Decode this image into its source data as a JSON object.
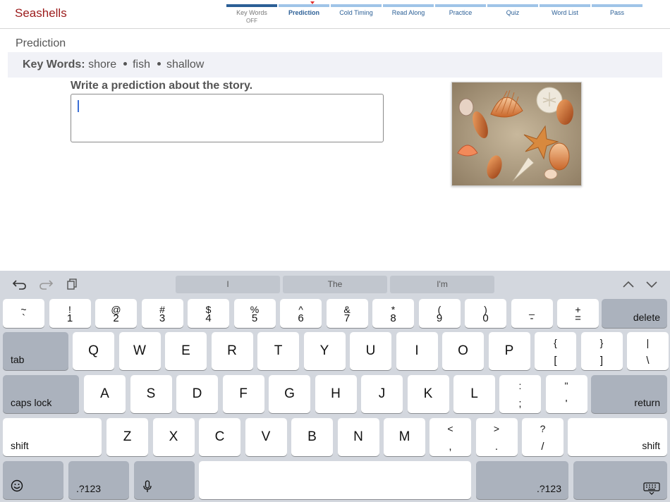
{
  "header": {
    "title": "Seashells"
  },
  "steps": [
    {
      "label": "Key Words",
      "sub": "OFF",
      "state": "done"
    },
    {
      "label": "Prediction",
      "state": "active"
    },
    {
      "label": "Cold Timing",
      "state": "todo"
    },
    {
      "label": "Read Along",
      "state": "todo"
    },
    {
      "label": "Practice",
      "state": "todo"
    },
    {
      "label": "Quiz",
      "state": "todo"
    },
    {
      "label": "Word List",
      "state": "todo"
    },
    {
      "label": "Pass",
      "state": "todo"
    }
  ],
  "section": {
    "title": "Prediction"
  },
  "keywords": {
    "label": "Key Words:",
    "words": [
      "shore",
      "fish",
      "shallow"
    ]
  },
  "prompt": {
    "text": "Write a prediction about the story.",
    "value": ""
  },
  "image": {
    "subject": "seashells and starfish on sand"
  },
  "keyboard": {
    "suggestions": [
      "I",
      "The",
      "I'm"
    ],
    "row1": [
      [
        "~",
        "`"
      ],
      [
        "!",
        "1"
      ],
      [
        "@",
        "2"
      ],
      [
        "#",
        "3"
      ],
      [
        "$",
        "4"
      ],
      [
        "%",
        "5"
      ],
      [
        "^",
        "6"
      ],
      [
        "&",
        "7"
      ],
      [
        "*",
        "8"
      ],
      [
        "(",
        "9"
      ],
      [
        ")",
        "0"
      ],
      [
        "_",
        "-"
      ],
      [
        "+",
        "="
      ]
    ],
    "row1_end": "delete",
    "row2_start": "tab",
    "row2": [
      "Q",
      "W",
      "E",
      "R",
      "T",
      "Y",
      "U",
      "I",
      "O",
      "P"
    ],
    "row2_pairs": [
      [
        "{",
        "["
      ],
      [
        "}",
        "]"
      ],
      [
        "|",
        "\\"
      ]
    ],
    "row3_start": "caps lock",
    "row3": [
      "A",
      "S",
      "D",
      "F",
      "G",
      "H",
      "J",
      "K",
      "L"
    ],
    "row3_pairs": [
      [
        ":",
        ";"
      ],
      [
        "\"",
        "'"
      ]
    ],
    "row3_end": "return",
    "row4_start": "shift",
    "row4": [
      "Z",
      "X",
      "C",
      "V",
      "B",
      "N",
      "M"
    ],
    "row4_pairs": [
      [
        "<",
        ","
      ],
      [
        ">",
        "."
      ],
      [
        "?",
        "/"
      ]
    ],
    "row4_end": "shift",
    "numbers_label": ".?123",
    "icons": [
      "undo-icon",
      "redo-icon",
      "paste-icon",
      "chevron-up-icon",
      "chevron-down-icon",
      "emoji-icon",
      "microphone-icon",
      "hide-keyboard-icon"
    ]
  }
}
